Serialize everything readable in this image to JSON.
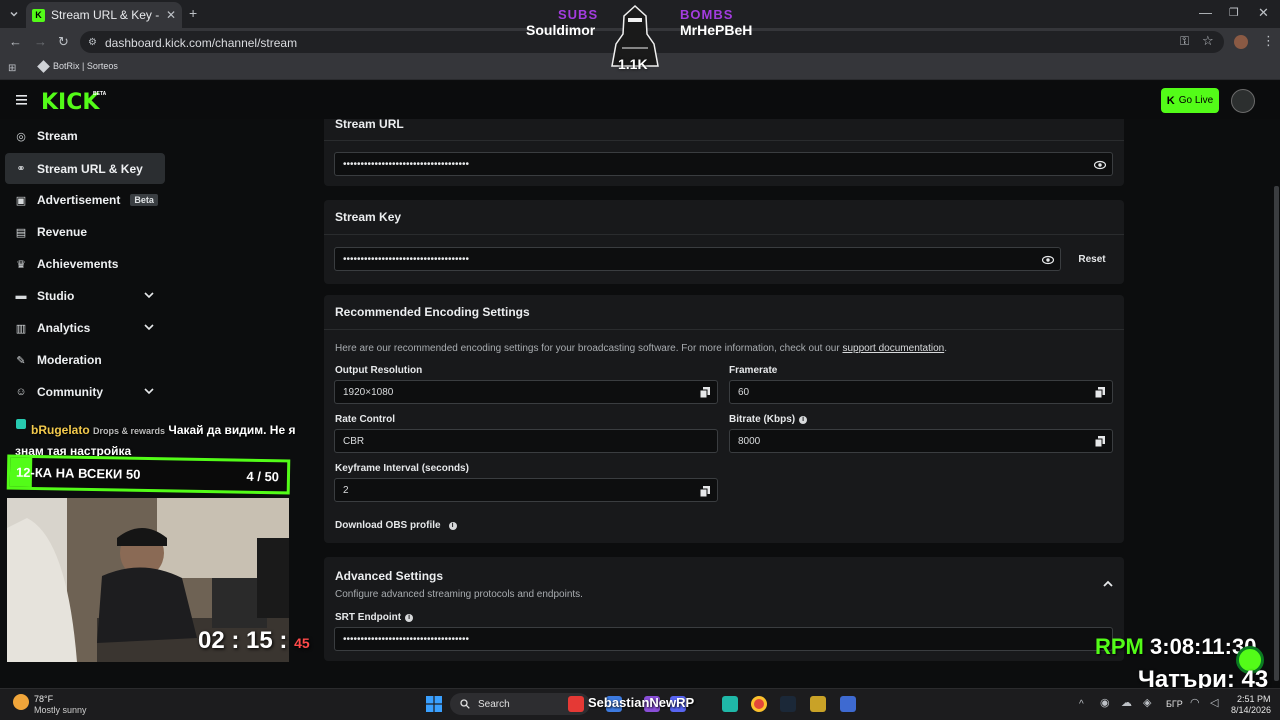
{
  "browser": {
    "tab_title": "Stream URL & Key - Kick Dashb",
    "url": "dashboard.kick.com/channel/stream",
    "bookmark": "BotRix | Sorteos"
  },
  "overlay_top": {
    "subs_label": "SUBS",
    "subs_name": "Souldimor",
    "bombs_label": "BOMBS",
    "bombs_name": "MrHePBeH",
    "count": "1.1K"
  },
  "header": {
    "logo": "KICK",
    "logo_tag": "BETA",
    "go_live": "Go Live"
  },
  "sidebar": {
    "items": [
      {
        "label": "Stream",
        "icon": "broadcast-icon"
      },
      {
        "label": "Stream URL & Key",
        "icon": "link-icon"
      },
      {
        "label": "Advertisement",
        "icon": "ad-icon",
        "badge": "Beta"
      },
      {
        "label": "Revenue",
        "icon": "chart-icon"
      },
      {
        "label": "Achievements",
        "icon": "trophy-icon"
      },
      {
        "label": "Studio",
        "icon": "studio-icon"
      },
      {
        "label": "Analytics",
        "icon": "analytics-icon"
      },
      {
        "label": "Moderation",
        "icon": "wrench-icon"
      },
      {
        "label": "Community",
        "icon": "people-icon"
      }
    ]
  },
  "stream_url": {
    "title": "Stream URL",
    "value": "••••••••••••••••••••••••••••••••••••"
  },
  "stream_key": {
    "title": "Stream Key",
    "value": "••••••••••••••••••••••••••••••••••••",
    "reset": "Reset"
  },
  "encoding": {
    "title": "Recommended Encoding Settings",
    "description": "Here are our recommended encoding settings for your broadcasting software. For more information, check out our",
    "link": "support documentation",
    "link_after": ".",
    "output_resolution_label": "Output Resolution",
    "output_resolution": "1920×1080",
    "framerate_label": "Framerate",
    "framerate": "60",
    "rate_control_label": "Rate Control",
    "rate_control": "CBR",
    "bitrate_label": "Bitrate (Kbps)",
    "bitrate": "8000",
    "keyframe_label": "Keyframe Interval (seconds)",
    "keyframe": "2",
    "download_obs": "Download OBS profile"
  },
  "advanced": {
    "title": "Advanced Settings",
    "description": "Configure advanced streaming protocols and endpoints.",
    "srt_label": "SRT Endpoint",
    "srt_value": "••••••••••••••••••••••••••••••••••••"
  },
  "stream_overlay": {
    "chat_user": "bRugelato",
    "chat_hidden": "Drops & rewards",
    "chat_text": "Чакай да видим. Не я знам тая настройка",
    "goal_text": "12-КА НА ВСЕКИ 50",
    "goal_count": "4 / 50",
    "goal_progress": 0.08,
    "timer": "02 : 15 :",
    "timer_seconds": "45",
    "rpm_label": "RPM",
    "rpm_value": "3:08:11:30",
    "chatters": "Чатъри: 43"
  },
  "taskbar": {
    "weather_temp": "78°F",
    "weather_desc": "Mostly sunny",
    "search": "Search",
    "overlay_name": "SebastianNewRP",
    "lang": "БГР",
    "time": "2:51 PM",
    "date": "8/14/2026"
  },
  "colors": {
    "kick_green": "#53fc18",
    "panel": "#18191b",
    "background": "#0c0d0e"
  }
}
